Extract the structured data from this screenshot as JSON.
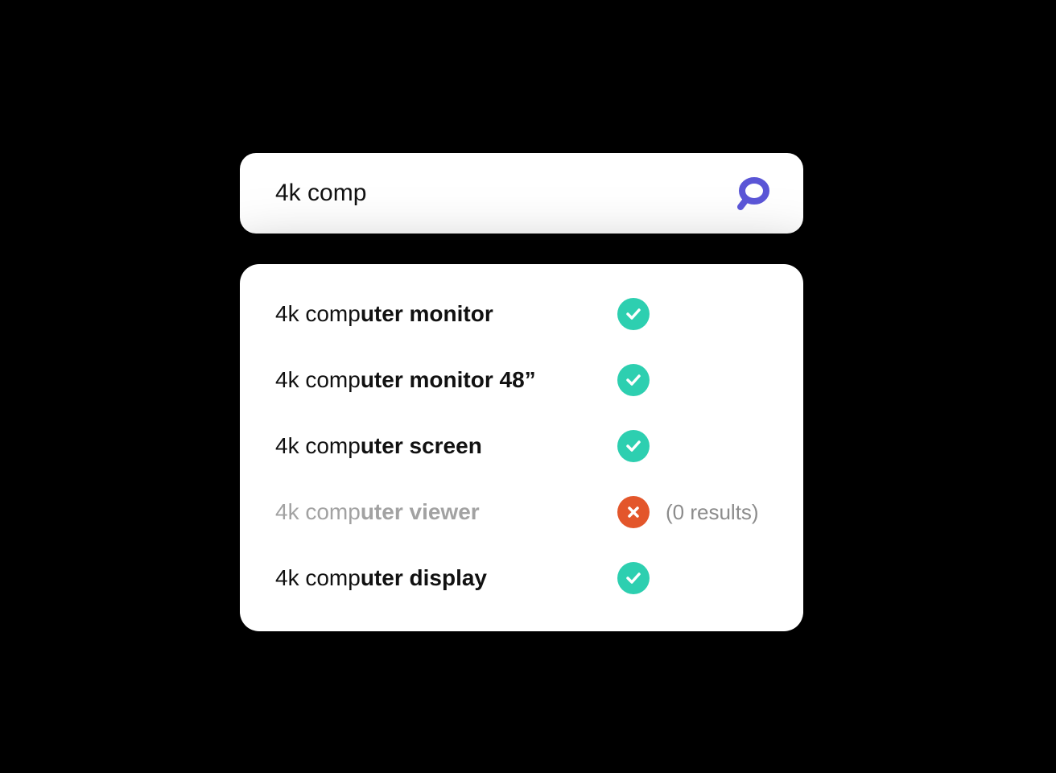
{
  "search": {
    "query": "4k comp"
  },
  "colors": {
    "accent": "#5a55d6",
    "success": "#2dcfb0",
    "error": "#e3562b"
  },
  "suggestions": [
    {
      "prefix": "4k comp",
      "suffix": "uter monitor",
      "status": "check",
      "muted": false,
      "note": ""
    },
    {
      "prefix": "4k comp",
      "suffix": "uter monitor 48”",
      "status": "check",
      "muted": false,
      "note": ""
    },
    {
      "prefix": "4k comp",
      "suffix": "uter screen",
      "status": "check",
      "muted": false,
      "note": ""
    },
    {
      "prefix": "4k comp",
      "suffix": "uter viewer",
      "status": "cross",
      "muted": true,
      "note": "(0 results)"
    },
    {
      "prefix": "4k comp",
      "suffix": "uter display",
      "status": "check",
      "muted": false,
      "note": ""
    }
  ]
}
